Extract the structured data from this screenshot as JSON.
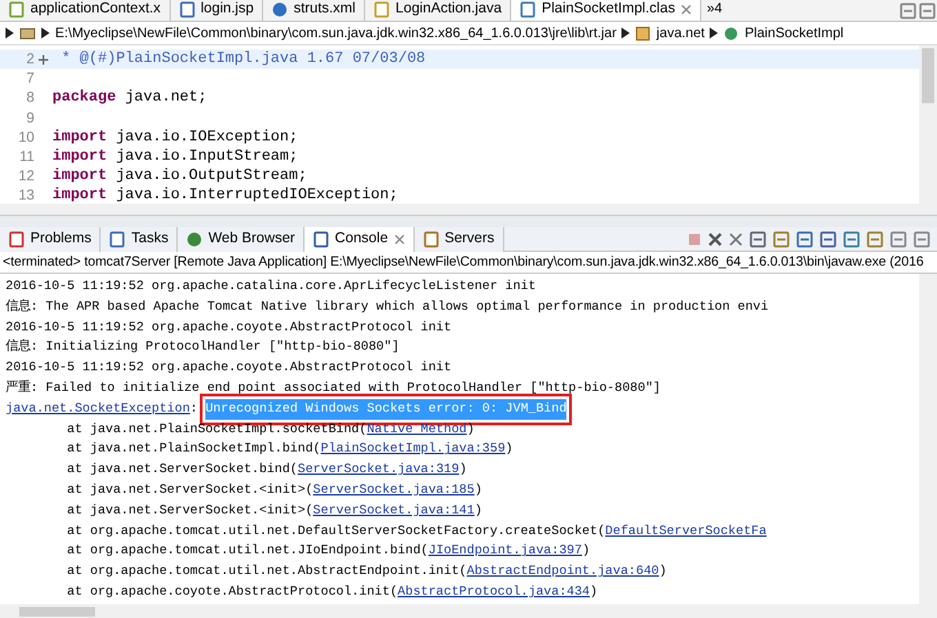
{
  "editor_tabs": [
    {
      "label": "applicationContext.x",
      "kind": "xml",
      "selected": false
    },
    {
      "label": "login.jsp",
      "kind": "jsp",
      "selected": false
    },
    {
      "label": "struts.xml",
      "kind": "gear",
      "selected": false
    },
    {
      "label": "LoginAction.java",
      "kind": "java",
      "selected": false
    },
    {
      "label": "PlainSocketImpl.clas",
      "kind": "class",
      "selected": true
    }
  ],
  "tab_overflow": "»4",
  "breadcrumb": [
    "E:\\Myeclipse\\NewFile\\Common\\binary\\com.sun.java.jdk.win32.x86_64_1.6.0.013\\jre\\lib\\rt.jar",
    "java.net",
    "PlainSocketImpl"
  ],
  "code_lines": [
    {
      "number": "2",
      "fold": true,
      "current": true,
      "segments": [
        {
          "text": " * @(#)PlainSocketImpl.java 1.67 07/03/08",
          "kind": "comment"
        }
      ]
    },
    {
      "number": "7",
      "fold": false,
      "current": false
    },
    {
      "number": "8",
      "fold": false,
      "current": false,
      "segments": [
        {
          "text": "package",
          "kind": "keyword"
        },
        {
          "text": " java.net;",
          "kind": "plain"
        }
      ]
    },
    {
      "number": "9",
      "fold": false,
      "current": false
    },
    {
      "number": "10",
      "fold": false,
      "current": false,
      "segments": [
        {
          "text": "import",
          "kind": "keyword"
        },
        {
          "text": " java.io.IOException;",
          "kind": "plain"
        }
      ]
    },
    {
      "number": "11",
      "fold": false,
      "current": false,
      "segments": [
        {
          "text": "import",
          "kind": "keyword"
        },
        {
          "text": " java.io.InputStream;",
          "kind": "plain"
        }
      ]
    },
    {
      "number": "12",
      "fold": false,
      "current": false,
      "segments": [
        {
          "text": "import",
          "kind": "keyword"
        },
        {
          "text": " java.io.OutputStream;",
          "kind": "plain"
        }
      ]
    },
    {
      "number": "13",
      "fold": false,
      "current": false,
      "segments": [
        {
          "text": "import",
          "kind": "keyword"
        },
        {
          "text": " java.io.InterruptedIOException;",
          "kind": "plain"
        }
      ]
    }
  ],
  "console_tabs": [
    {
      "label": "Problems",
      "kind": "problems",
      "selected": false
    },
    {
      "label": "Tasks",
      "kind": "tasks",
      "selected": false
    },
    {
      "label": "Web Browser",
      "kind": "globe",
      "selected": false
    },
    {
      "label": "Console",
      "kind": "console",
      "selected": true
    },
    {
      "label": "Servers",
      "kind": "servers",
      "selected": false
    }
  ],
  "console_header": "<terminated> tomcat7Server [Remote Java Application] E:\\Myeclipse\\NewFile\\Common\\binary\\com.sun.java.jdk.win32.x86_64_1.6.0.013\\bin\\javaw.exe (2016",
  "console_lines": [
    [
      {
        "text": "2016-10-5 11:19:52 org.apache.catalina.core.AprLifecycleListener init",
        "kind": "text"
      }
    ],
    [
      {
        "text": "信息: The APR based Apache Tomcat Native library which allows optimal performance in production envi",
        "kind": "text"
      }
    ],
    [
      {
        "text": "2016-10-5 11:19:52 org.apache.coyote.AbstractProtocol init",
        "kind": "text"
      }
    ],
    [
      {
        "text": "信息: Initializing ProtocolHandler [\"http-bio-8080\"]",
        "kind": "text"
      }
    ],
    [
      {
        "text": "2016-10-5 11:19:52 org.apache.coyote.AbstractProtocol init",
        "kind": "text"
      }
    ],
    [
      {
        "text": "严重: Failed to initialize end point associated with ProtocolHandler [\"http-bio-8080\"]",
        "kind": "text"
      }
    ],
    [
      {
        "text": "java.net.SocketException",
        "kind": "link"
      },
      {
        "text": ": ",
        "kind": "text"
      },
      {
        "text": "Unrecognized Windows Sockets error: 0: JVM_Bind",
        "kind": "highlight"
      }
    ],
    [
      {
        "text": "        at java.net.PlainSocketImpl.socketBind(",
        "kind": "text"
      },
      {
        "text": "Native Method",
        "kind": "link"
      },
      {
        "text": ")",
        "kind": "text"
      }
    ],
    [
      {
        "text": "        at java.net.PlainSocketImpl.bind(",
        "kind": "text"
      },
      {
        "text": "PlainSocketImpl.java:359",
        "kind": "link"
      },
      {
        "text": ")",
        "kind": "text"
      }
    ],
    [
      {
        "text": "        at java.net.ServerSocket.bind(",
        "kind": "text"
      },
      {
        "text": "ServerSocket.java:319",
        "kind": "link"
      },
      {
        "text": ")",
        "kind": "text"
      }
    ],
    [
      {
        "text": "        at java.net.ServerSocket.<init>(",
        "kind": "text"
      },
      {
        "text": "ServerSocket.java:185",
        "kind": "link"
      },
      {
        "text": ")",
        "kind": "text"
      }
    ],
    [
      {
        "text": "        at java.net.ServerSocket.<init>(",
        "kind": "text"
      },
      {
        "text": "ServerSocket.java:141",
        "kind": "link"
      },
      {
        "text": ")",
        "kind": "text"
      }
    ],
    [
      {
        "text": "        at org.apache.tomcat.util.net.DefaultServerSocketFactory.createSocket(",
        "kind": "text"
      },
      {
        "text": "DefaultServerSocketFa",
        "kind": "link"
      }
    ],
    [
      {
        "text": "        at org.apache.tomcat.util.net.JIoEndpoint.bind(",
        "kind": "text"
      },
      {
        "text": "JIoEndpoint.java:397",
        "kind": "link"
      },
      {
        "text": ")",
        "kind": "text"
      }
    ],
    [
      {
        "text": "        at org.apache.tomcat.util.net.AbstractEndpoint.init(",
        "kind": "text"
      },
      {
        "text": "AbstractEndpoint.java:640",
        "kind": "link"
      },
      {
        "text": ")",
        "kind": "text"
      }
    ],
    [
      {
        "text": "        at org.apache.coyote.AbstractProtocol.init(",
        "kind": "text"
      },
      {
        "text": "AbstractProtocol.java:434",
        "kind": "link"
      },
      {
        "text": ")",
        "kind": "text"
      }
    ]
  ]
}
